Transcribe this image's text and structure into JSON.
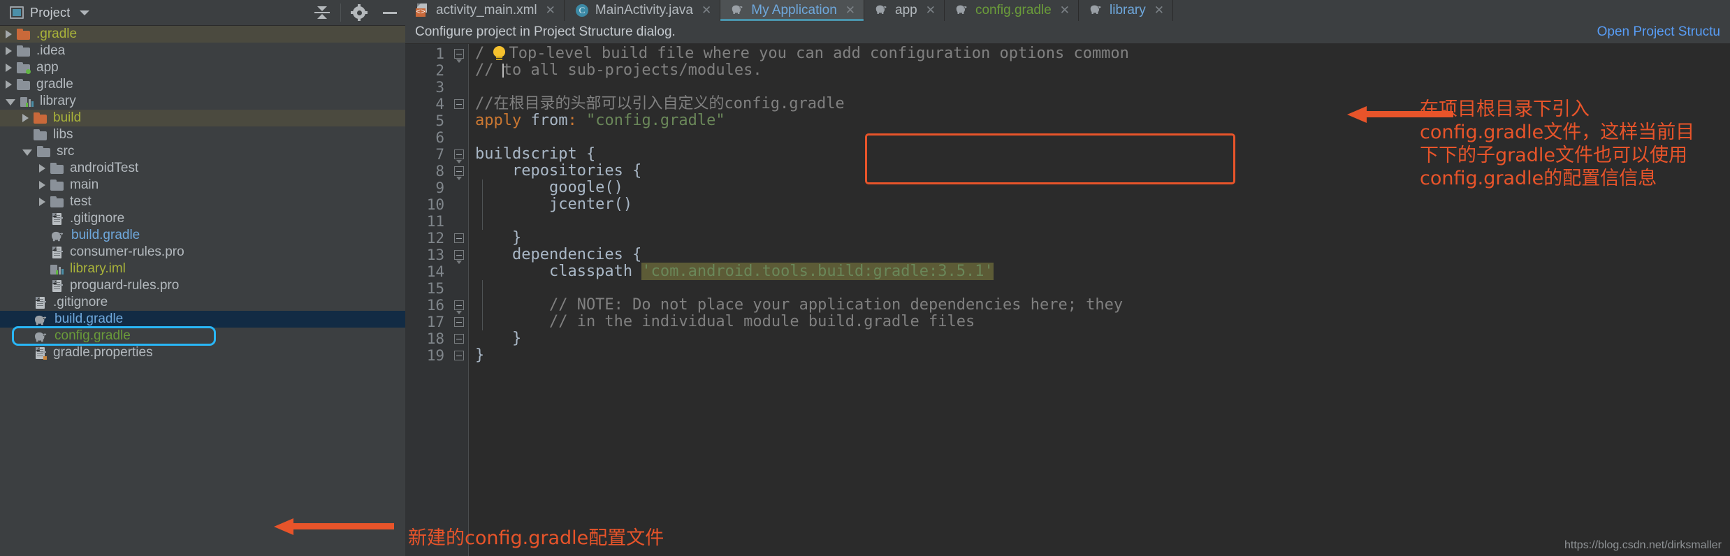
{
  "project_panel": {
    "title": "Project",
    "toolbar": [
      {
        "name": "collapse-all-icon",
        "label": "Collapse All"
      },
      {
        "name": "settings-gear-icon",
        "label": "Settings"
      },
      {
        "name": "hide-panel-icon",
        "label": "Hide"
      }
    ],
    "tree": [
      {
        "label": ".gradle",
        "indent": 1,
        "arrow": "closed",
        "icon": "folder-orange",
        "color": "olive",
        "row_bg": "olive"
      },
      {
        "label": ".idea",
        "indent": 1,
        "arrow": "closed",
        "icon": "folder",
        "color": "grey",
        "row_bg": "none"
      },
      {
        "label": "app",
        "indent": 1,
        "arrow": "closed",
        "icon": "folder-dot",
        "color": "grey",
        "row_bg": "none"
      },
      {
        "label": "gradle",
        "indent": 1,
        "arrow": "closed",
        "icon": "folder",
        "color": "grey",
        "row_bg": "none"
      },
      {
        "label": "library",
        "indent": 1,
        "arrow": "open",
        "icon": "module",
        "color": "grey",
        "row_bg": "none"
      },
      {
        "label": "build",
        "indent": 2,
        "arrow": "closed",
        "icon": "folder-orange",
        "color": "olive",
        "row_bg": "olive"
      },
      {
        "label": "libs",
        "indent": 2,
        "arrow": "none",
        "icon": "folder",
        "color": "grey",
        "row_bg": "none"
      },
      {
        "label": "src",
        "indent": 2,
        "arrow": "open",
        "icon": "folder",
        "color": "grey",
        "row_bg": "none"
      },
      {
        "label": "androidTest",
        "indent": 3,
        "arrow": "closed",
        "icon": "folder",
        "color": "grey",
        "row_bg": "none"
      },
      {
        "label": "main",
        "indent": 3,
        "arrow": "closed",
        "icon": "folder",
        "color": "grey",
        "row_bg": "none"
      },
      {
        "label": "test",
        "indent": 3,
        "arrow": "closed",
        "icon": "folder",
        "color": "grey",
        "row_bg": "none"
      },
      {
        "label": ".gitignore",
        "indent": 3,
        "arrow": "none",
        "icon": "file",
        "color": "grey",
        "row_bg": "none"
      },
      {
        "label": "build.gradle",
        "indent": 3,
        "arrow": "none",
        "icon": "gradle",
        "color": "blue",
        "row_bg": "none"
      },
      {
        "label": "consumer-rules.pro",
        "indent": 3,
        "arrow": "none",
        "icon": "file",
        "color": "grey",
        "row_bg": "none"
      },
      {
        "label": "library.iml",
        "indent": 3,
        "arrow": "none",
        "icon": "module",
        "color": "olive",
        "row_bg": "none"
      },
      {
        "label": "proguard-rules.pro",
        "indent": 3,
        "arrow": "none",
        "icon": "file",
        "color": "grey",
        "row_bg": "none"
      },
      {
        "label": ".gitignore",
        "indent": 2,
        "arrow": "none",
        "icon": "file",
        "color": "grey",
        "row_bg": "none"
      },
      {
        "label": "build.gradle",
        "indent": 2,
        "arrow": "none",
        "icon": "gradle",
        "color": "blue",
        "row_bg": "blue"
      },
      {
        "label": "config.gradle",
        "indent": 2,
        "arrow": "none",
        "icon": "gradle",
        "color": "green",
        "row_bg": "none"
      },
      {
        "label": "gradle.properties",
        "indent": 2,
        "arrow": "none",
        "icon": "file-prop",
        "color": "grey",
        "row_bg": "none"
      }
    ]
  },
  "editor": {
    "tabs": [
      {
        "label": "activity_main.xml",
        "icon": "xml-layout-icon",
        "active": false,
        "color": "#b3b9be",
        "close": "✕"
      },
      {
        "label": "MainActivity.java",
        "icon": "java-class-icon",
        "active": false,
        "color": "#b3b9be",
        "close": "✕"
      },
      {
        "label": "My Application",
        "icon": "gradle-icon",
        "active": true,
        "color": "#6fa8dc",
        "close": "✕"
      },
      {
        "label": "app",
        "icon": "gradle-icon",
        "active": false,
        "color": "#b3b9be",
        "close": "✕"
      },
      {
        "label": "config.gradle",
        "icon": "gradle-icon",
        "active": false,
        "color": "#6a9b3a",
        "close": "✕"
      },
      {
        "label": "library",
        "icon": "gradle-icon",
        "active": false,
        "color": "#6fa8dc",
        "close": "✕"
      }
    ],
    "notification": {
      "text": "Configure project in Project Structure dialog.",
      "link": "Open Project Structu"
    },
    "line_numbers": [
      1,
      2,
      3,
      4,
      5,
      6,
      7,
      8,
      9,
      10,
      11,
      12,
      13,
      14,
      15,
      16,
      17,
      18,
      19
    ],
    "code_lines": [
      {
        "n": 1,
        "segments": [
          {
            "t": "/",
            "c": "comment"
          },
          {
            "t": " Top-level build file where you can add configuration options common",
            "c": "comment"
          }
        ],
        "bulb": true
      },
      {
        "n": 2,
        "segments": [
          {
            "t": "// ",
            "c": "comment"
          },
          {
            "t": "|",
            "c": "caret"
          },
          {
            "t": "to all sub-projects/modules.",
            "c": "comment"
          }
        ]
      },
      {
        "n": 3,
        "segments": []
      },
      {
        "n": 4,
        "segments": [
          {
            "t": "//在根目录的头部可以引入自定义的config.gradle",
            "c": "comment"
          }
        ]
      },
      {
        "n": 5,
        "segments": [
          {
            "t": "apply ",
            "c": "kw"
          },
          {
            "t": "from",
            "c": "plain"
          },
          {
            "t": ": ",
            "c": "kw"
          },
          {
            "t": "\"config.gradle\"",
            "c": "str2"
          }
        ]
      },
      {
        "n": 6,
        "segments": []
      },
      {
        "n": 7,
        "segments": [
          {
            "t": "buildscript {",
            "c": "plain"
          }
        ]
      },
      {
        "n": 8,
        "segments": [
          {
            "t": "    repositories {",
            "c": "plain"
          }
        ]
      },
      {
        "n": 9,
        "segments": [
          {
            "t": "        google()",
            "c": "plain"
          }
        ]
      },
      {
        "n": 10,
        "segments": [
          {
            "t": "        jcenter()",
            "c": "plain"
          }
        ]
      },
      {
        "n": 11,
        "segments": []
      },
      {
        "n": 12,
        "segments": [
          {
            "t": "    }",
            "c": "plain"
          }
        ]
      },
      {
        "n": 13,
        "segments": [
          {
            "t": "    dependencies {",
            "c": "plain"
          }
        ]
      },
      {
        "n": 14,
        "segments": [
          {
            "t": "        classpath ",
            "c": "plain"
          },
          {
            "t": "'com.android.tools.build:gradle:3.5.1'",
            "c": "str"
          }
        ]
      },
      {
        "n": 15,
        "segments": []
      },
      {
        "n": 16,
        "segments": [
          {
            "t": "        // NOTE: Do not place your application dependencies here; they",
            "c": "comment"
          }
        ]
      },
      {
        "n": 17,
        "segments": [
          {
            "t": "        // in the individual module build.gradle files",
            "c": "comment"
          }
        ]
      },
      {
        "n": 18,
        "segments": [
          {
            "t": "    }",
            "c": "plain"
          }
        ]
      },
      {
        "n": 19,
        "segments": [
          {
            "t": "}",
            "c": "plain"
          }
        ]
      }
    ]
  },
  "annotations": {
    "right_note": "在项目根目录下引入config.gradle文件，这样当前目下下的子gradle文件也可以使用config.gradle的配置信信息",
    "bottom_note": "新建的config.gradle配置文件",
    "highlight_color": "#e8542a",
    "selection_box_color": "#29b6f6"
  },
  "watermark": "https://blog.csdn.net/dirksmaller"
}
